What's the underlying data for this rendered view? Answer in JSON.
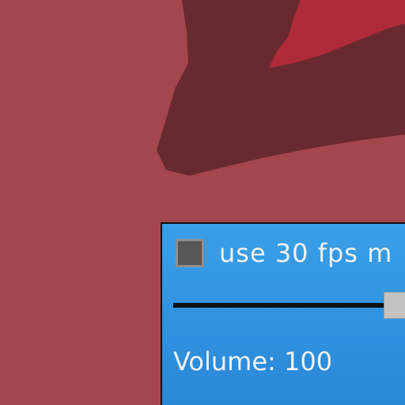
{
  "settings_panel": {
    "fps_checkbox": {
      "label": "use 30 fps m",
      "checked": false
    },
    "volume_slider": {
      "value": 100,
      "max": 100
    },
    "volume_label": "Volume: 100"
  },
  "colors": {
    "background": "#a4464e",
    "shadow_shape": "#682a2f",
    "bright_shape": "#b02b39",
    "panel": "#2e91e0",
    "text": "#f2f2f2",
    "checkbox_fill": "#575757",
    "slider_handle": "#c2c2c2"
  }
}
